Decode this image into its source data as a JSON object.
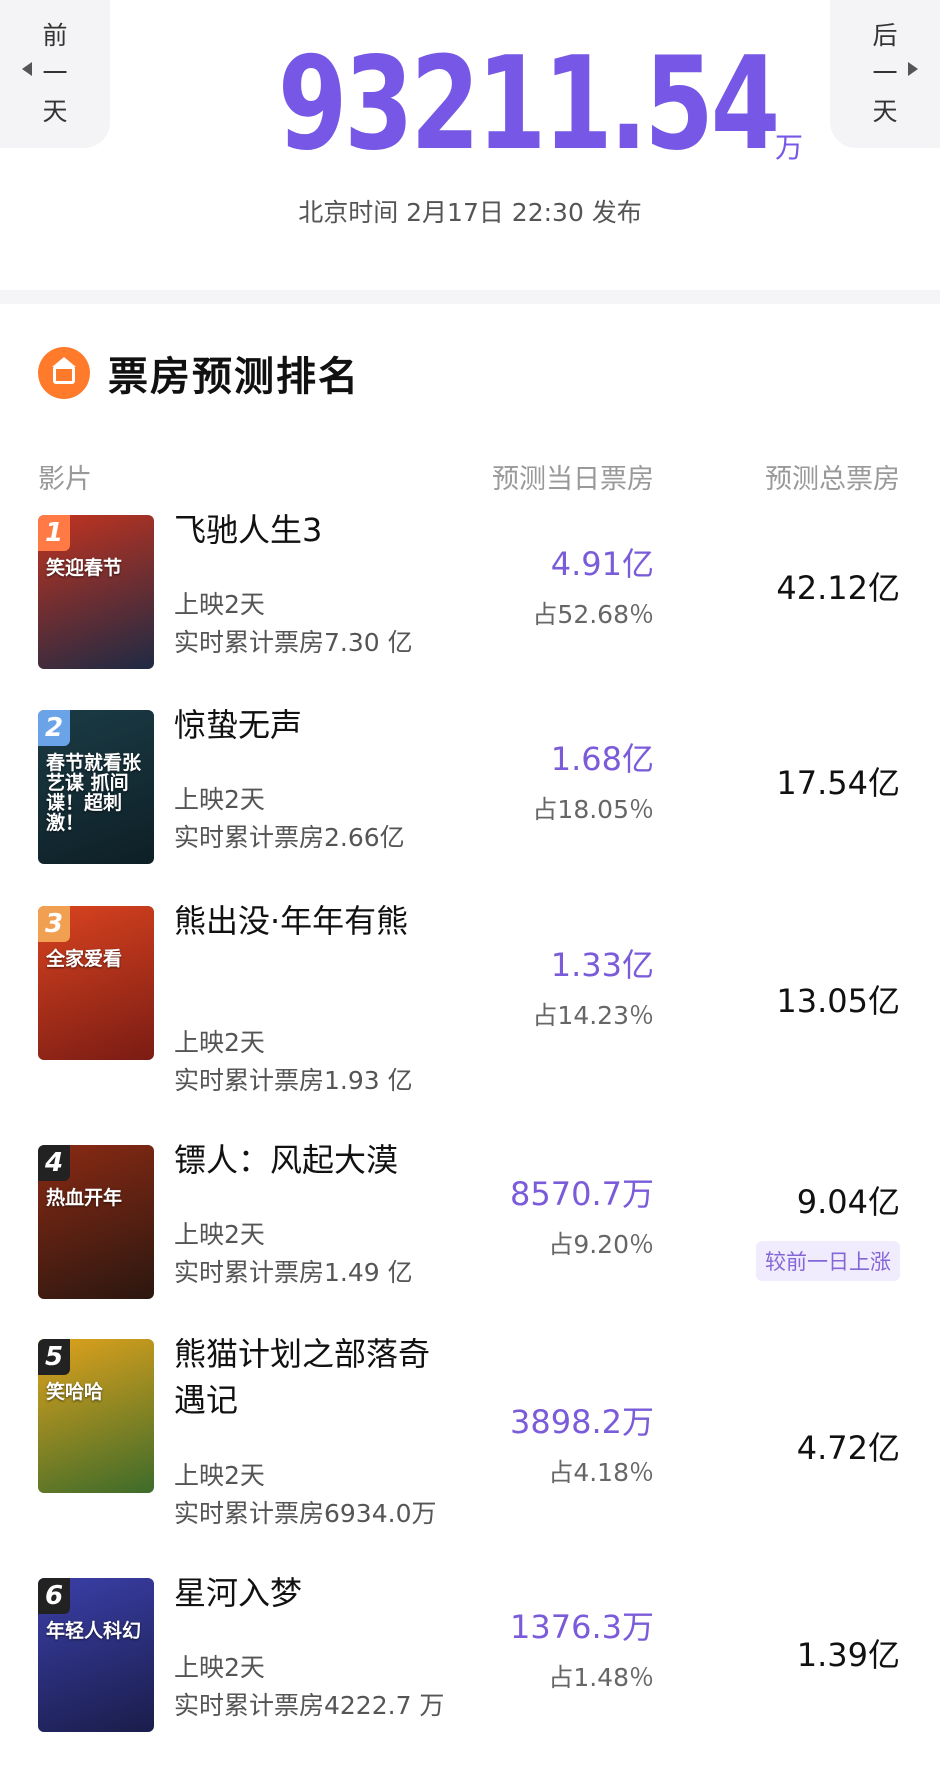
{
  "header": {
    "prev_day": [
      "前",
      "一",
      "天"
    ],
    "next_day": [
      "后",
      "一",
      "天"
    ],
    "total_value": "93211.54",
    "total_unit": "万",
    "publish_info": "北京时间 2月17日 22:30 发布"
  },
  "ranking": {
    "title": "票房预测排名",
    "columns": {
      "movie": "影片",
      "day": "预测当日票房",
      "total": "预测总票房"
    },
    "movies": [
      {
        "rank": "1",
        "title": "飞驰人生3",
        "days": "上映2天",
        "cumulative": "实时累计票房7.30 亿",
        "day_box": "4.91亿",
        "share": "占52.68％",
        "total": "42.12亿",
        "poster_text": "笑迎春节",
        "poster_colors": [
          "#c2331f",
          "#1e2a44"
        ],
        "rank_color": "#ff7a45"
      },
      {
        "rank": "2",
        "title": "惊蛰无声",
        "days": "上映2天",
        "cumulative": "实时累计票房2.66亿",
        "day_box": "1.68亿",
        "share": "占18.05％",
        "total": "17.54亿",
        "poster_text": "春节就看张艺谋 抓间谍！超刺激！",
        "poster_colors": [
          "#1b3b45",
          "#0e1f26"
        ],
        "rank_color": "#6aa3e8"
      },
      {
        "rank": "3",
        "title": "熊出没·年年有熊",
        "days": "上映2天",
        "cumulative": "实时累计票房1.93 亿",
        "day_box": "1.33亿",
        "share": "占14.23％",
        "total": "13.05亿",
        "poster_text": "全家爱看",
        "poster_colors": [
          "#d9431f",
          "#7a1c14"
        ],
        "rank_color": "#f0a050"
      },
      {
        "rank": "4",
        "title": "镖人：风起大漠",
        "days": "上映2天",
        "cumulative": "实时累计票房1.49 亿",
        "day_box": "8570.7万",
        "share": "占9.20％",
        "total": "9.04亿",
        "rise_tag": "较前一日上涨",
        "poster_text": "热血开年",
        "poster_colors": [
          "#8a2a14",
          "#2b1710"
        ],
        "rank_color": "#222222"
      },
      {
        "rank": "5",
        "title": "熊猫计划之部落奇遇记",
        "days": "上映2天",
        "cumulative": "实时累计票房6934.0万",
        "day_box": "3898.2万",
        "share": "占4.18％",
        "total": "4.72亿",
        "poster_text": "笑哈哈",
        "poster_colors": [
          "#e0a21c",
          "#3d6b2a"
        ],
        "rank_color": "#222222"
      },
      {
        "rank": "6",
        "title": "星河入梦",
        "days": "上映2天",
        "cumulative": "实时累计票房4222.7 万",
        "day_box": "1376.3万",
        "share": "占1.48％",
        "total": "1.39亿",
        "poster_text": "年轻人科幻",
        "poster_colors": [
          "#3b3fa8",
          "#1a1d4a"
        ],
        "rank_color": "#222222"
      }
    ]
  }
}
